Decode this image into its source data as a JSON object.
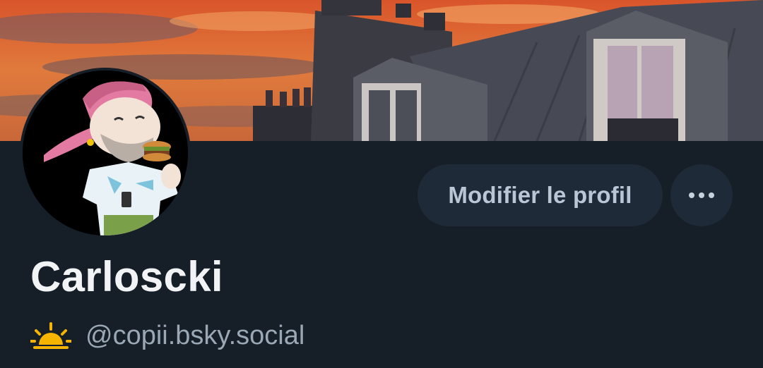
{
  "profile": {
    "display_name": "Carloscki",
    "handle": "@copii.bsky.social",
    "avatar_icon": "cartoon-avatar-burger",
    "banner_icon": "paris-rooftops-sunset",
    "status_icon": "sunrise-icon"
  },
  "actions": {
    "edit_label": "Modifier le profil",
    "more_icon": "ellipsis-icon"
  },
  "colors": {
    "background": "#161e27",
    "button_bg": "#1f2a38",
    "button_text": "#b9c6d5",
    "name_text": "#f1f3f5",
    "handle_text": "#9aa7b5",
    "sun": "#f4b400"
  }
}
